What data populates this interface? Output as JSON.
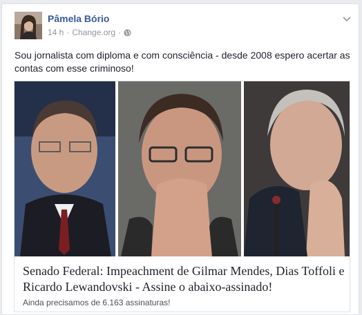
{
  "post": {
    "author": "Pâmela Bório",
    "time": "14 h",
    "source": "Change.org",
    "separator": "·",
    "privacy_icon": "globe-icon",
    "menu_icon": "chevron-down-icon",
    "text": "Sou jornalista com diploma e com consciência - desde 2008 espero acertar as contas com esse criminoso!"
  },
  "link": {
    "title": "Senado Federal: Impeachment de Gilmar Mendes, Dias Toffoli e Ricardo Lewandovski - Assine o abaixo-assinado!",
    "subtitle": "Ainda precisamos de 6.163 assinaturas!"
  },
  "colors": {
    "author_link": "#365899",
    "meta_gray": "#90949c",
    "body_text": "#1d2129",
    "border": "#dddfe2"
  }
}
